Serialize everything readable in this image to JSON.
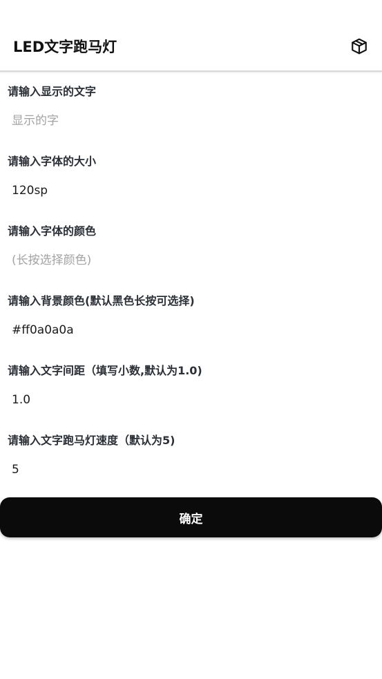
{
  "toolbar": {
    "title": "LED文字跑马灯",
    "action_icon": "cube-icon"
  },
  "fields": [
    {
      "label": "请输入显示的文字",
      "value": "",
      "placeholder": "显示的字"
    },
    {
      "label": "请输入字体的大小",
      "value": "120sp",
      "placeholder": ""
    },
    {
      "label": "请输入字体的颜色",
      "value": "",
      "placeholder": "(长按选择颜色)"
    },
    {
      "label": "请输入背景颜色(默认黑色长按可选择)",
      "value": "#ff0a0a0a",
      "placeholder": ""
    },
    {
      "label": "请输入文字间距（填写小数,默认为1.0)",
      "value": "1.0",
      "placeholder": ""
    },
    {
      "label": "请输入文字跑马灯速度（默认为5)",
      "value": "5",
      "placeholder": ""
    }
  ],
  "confirm_button": {
    "label": "确定"
  },
  "colors": {
    "button_bg": "#0b0b0b",
    "label_text": "#2b2f36",
    "placeholder_text": "#a3a3a3"
  }
}
